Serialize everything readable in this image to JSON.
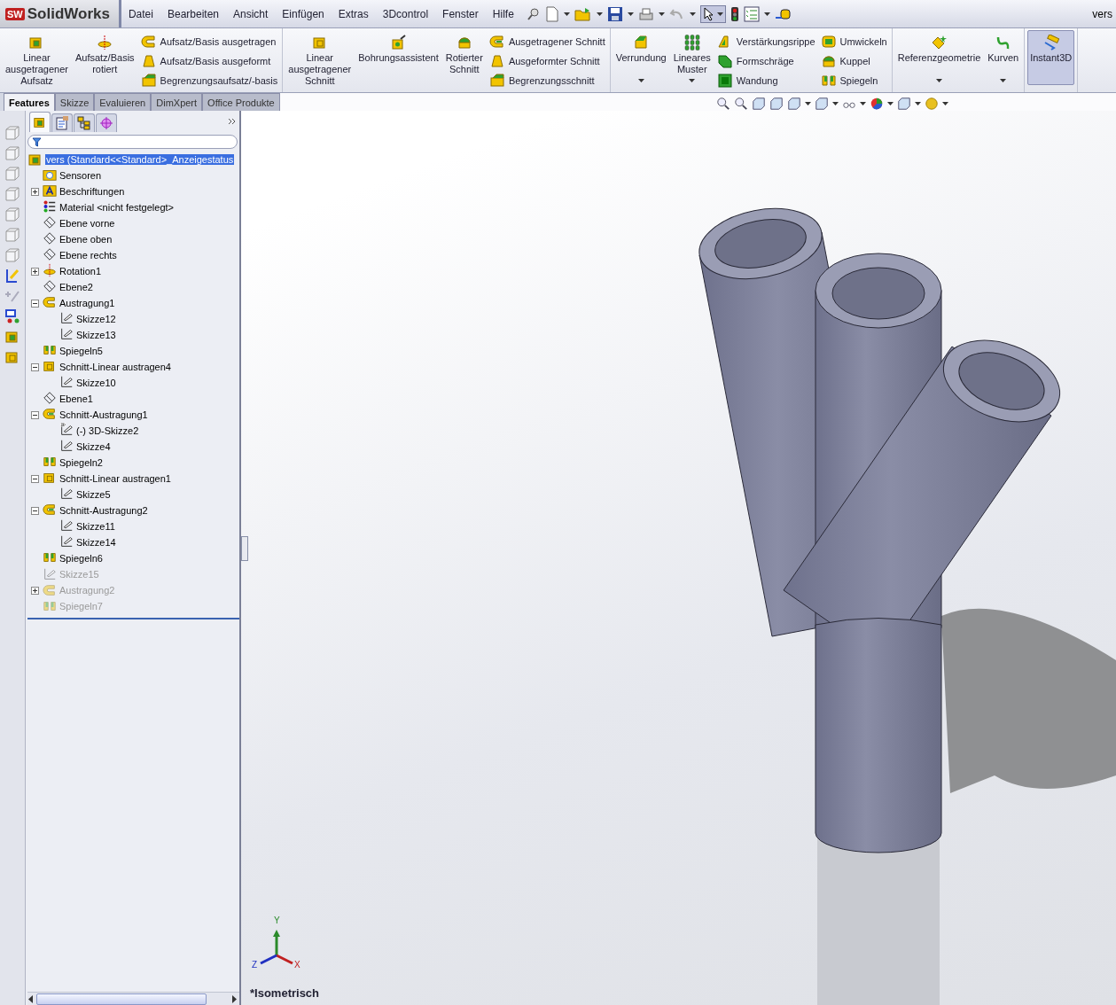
{
  "title_bar": {
    "logo_badge": "SW",
    "logo_text": "SolidWorks",
    "menu": [
      "Datei",
      "Bearbeiten",
      "Ansicht",
      "Einfügen",
      "Extras",
      "3Dcontrol",
      "Fenster",
      "Hilfe"
    ],
    "document": "vers"
  },
  "ribbon": {
    "groups": [
      {
        "items": [
          {
            "kind": "large",
            "label": "Linear ausgetragener Aufsatz",
            "menu": false,
            "active": false
          },
          {
            "kind": "large",
            "label": "Aufsatz/Basis rotiert",
            "menu": false,
            "active": false
          },
          {
            "kind": "small",
            "label": "Aufsatz/Basis ausgetragen",
            "menu": false,
            "active": false
          },
          {
            "kind": "small",
            "label": "Aufsatz/Basis ausgeformt",
            "menu": false,
            "active": false
          },
          {
            "kind": "small",
            "label": "Begrenzungsaufsatz/-basis",
            "menu": false,
            "active": false
          }
        ]
      },
      {
        "items": [
          {
            "kind": "large",
            "label": "Linear ausgetragener Schnitt",
            "menu": false,
            "active": false
          },
          {
            "kind": "large",
            "label": "Bohrungsassistent",
            "menu": false,
            "active": false
          },
          {
            "kind": "large",
            "label": "Rotierter Schnitt",
            "menu": false,
            "active": false
          },
          {
            "kind": "small",
            "label": "Ausgetragener Schnitt",
            "menu": false,
            "active": false
          },
          {
            "kind": "small",
            "label": "Ausgeformter Schnitt",
            "menu": false,
            "active": false
          },
          {
            "kind": "small",
            "label": "Begrenzungsschnitt",
            "menu": false,
            "active": false
          }
        ]
      },
      {
        "items": [
          {
            "kind": "large",
            "label": "Verrundung",
            "menu": true,
            "active": false
          },
          {
            "kind": "large",
            "label": "Lineares Muster",
            "menu": true,
            "active": false
          },
          {
            "kind": "small",
            "label": "Verstärkungsrippe",
            "menu": false,
            "active": false
          },
          {
            "kind": "small",
            "label": "Formschräge",
            "menu": false,
            "active": false
          },
          {
            "kind": "small",
            "label": "Wandung",
            "menu": false,
            "active": false
          },
          {
            "kind": "small",
            "label": "Umwickeln",
            "menu": false,
            "active": false
          },
          {
            "kind": "small",
            "label": "Kuppel",
            "menu": false,
            "active": false
          },
          {
            "kind": "small",
            "label": "Spiegeln",
            "menu": false,
            "active": false
          }
        ]
      },
      {
        "items": [
          {
            "kind": "large",
            "label": "Referenzgeometrie",
            "menu": true,
            "active": false
          },
          {
            "kind": "large",
            "label": "Kurven",
            "menu": true,
            "active": false
          }
        ]
      },
      {
        "items": [
          {
            "kind": "large",
            "label": "Instant3D",
            "menu": false,
            "active": true
          }
        ]
      }
    ]
  },
  "tabs": [
    {
      "label": "Features",
      "selected": true
    },
    {
      "label": "Skizze",
      "selected": false
    },
    {
      "label": "Evaluieren",
      "selected": false
    },
    {
      "label": "DimXpert",
      "selected": false
    },
    {
      "label": "Office Produkte",
      "selected": false
    }
  ],
  "panel_tabs": [
    {
      "kind": "features",
      "selected": true
    },
    {
      "kind": "properties",
      "selected": false
    },
    {
      "kind": "config",
      "selected": false
    },
    {
      "kind": "display",
      "selected": false
    }
  ],
  "tree": {
    "root": {
      "label": "vers  (Standard<<Standard>_Anzeigestatus",
      "selected": true
    },
    "items": [
      {
        "label": "Sensoren",
        "kind": "sensor",
        "suppressed": false
      },
      {
        "label": "Beschriftungen",
        "kind": "annotation",
        "expanded": false,
        "suppressed": false
      },
      {
        "label": "Material <nicht festgelegt>",
        "kind": "material",
        "suppressed": false
      },
      {
        "label": "Ebene vorne",
        "kind": "plane",
        "suppressed": false
      },
      {
        "label": "Ebene oben",
        "kind": "plane",
        "suppressed": false
      },
      {
        "label": "Ebene rechts",
        "kind": "plane",
        "suppressed": false
      },
      {
        "label": "Rotation1",
        "kind": "revolve",
        "expanded": false,
        "suppressed": false
      },
      {
        "label": "Ebene2",
        "kind": "plane",
        "suppressed": false
      },
      {
        "label": "Austragung1",
        "kind": "sweep",
        "expanded": true,
        "suppressed": false,
        "children": [
          {
            "label": "Skizze12",
            "kind": "sketch",
            "suppressed": false
          },
          {
            "label": "Skizze13",
            "kind": "sketch",
            "suppressed": false
          }
        ]
      },
      {
        "label": "Spiegeln5",
        "kind": "mirror",
        "suppressed": false
      },
      {
        "label": "Schnitt-Linear austragen4",
        "kind": "cut",
        "expanded": true,
        "suppressed": false,
        "children": [
          {
            "label": "Skizze10",
            "kind": "sketch",
            "suppressed": false
          }
        ]
      },
      {
        "label": "Ebene1",
        "kind": "plane",
        "suppressed": false
      },
      {
        "label": "Schnitt-Austragung1",
        "kind": "cutsweep",
        "expanded": true,
        "suppressed": false,
        "children": [
          {
            "label": "(-) 3D-Skizze2",
            "kind": "sketch3d",
            "suppressed": false
          },
          {
            "label": "Skizze4",
            "kind": "sketch",
            "suppressed": false
          }
        ]
      },
      {
        "label": "Spiegeln2",
        "kind": "mirror",
        "suppressed": false
      },
      {
        "label": "Schnitt-Linear austragen1",
        "kind": "cut",
        "expanded": true,
        "suppressed": false,
        "children": [
          {
            "label": "Skizze5",
            "kind": "sketch",
            "suppressed": false
          }
        ]
      },
      {
        "label": "Schnitt-Austragung2",
        "kind": "cutsweep",
        "expanded": true,
        "suppressed": false,
        "children": [
          {
            "label": "Skizze11",
            "kind": "sketch",
            "suppressed": false
          },
          {
            "label": "Skizze14",
            "kind": "sketch",
            "suppressed": false
          }
        ]
      },
      {
        "label": "Spiegeln6",
        "kind": "mirror",
        "suppressed": false
      },
      {
        "label": "Skizze15",
        "kind": "sketch",
        "suppressed": true
      },
      {
        "label": "Austragung2",
        "kind": "sweep",
        "expanded": false,
        "suppressed": true
      },
      {
        "label": "Spiegeln7",
        "kind": "mirror",
        "suppressed": true
      }
    ]
  },
  "viewport": {
    "view_name": "*Isometrisch",
    "axes": {
      "x": "X",
      "y": "Y",
      "z": "Z"
    }
  }
}
